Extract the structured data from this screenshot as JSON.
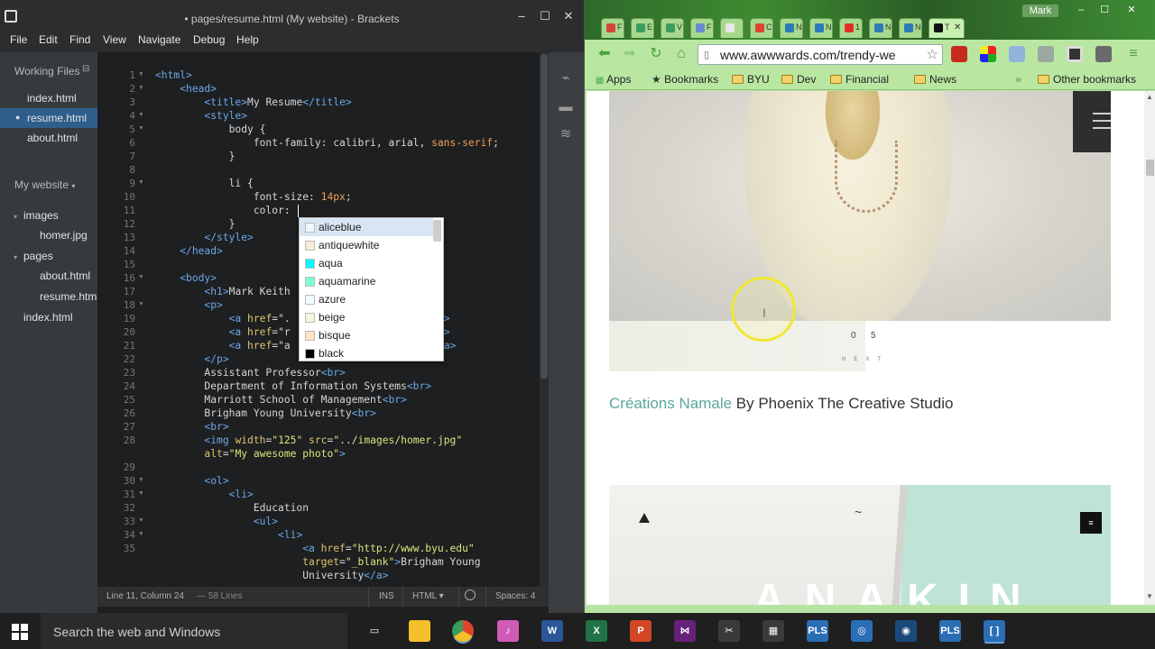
{
  "brackets": {
    "title": "• pages/resume.html (My website) - Brackets",
    "window_buttons": [
      "–",
      "☐",
      "✕"
    ],
    "menu": [
      "File",
      "Edit",
      "Find",
      "View",
      "Navigate",
      "Debug",
      "Help"
    ],
    "sidebar": {
      "working_files_label": "Working Files",
      "working_files": [
        "index.html",
        "resume.html",
        "about.html"
      ],
      "active_file_index": 1,
      "project_label": "My website",
      "tree": [
        {
          "label": "images",
          "type": "folder"
        },
        {
          "label": "homer.jpg",
          "type": "file"
        },
        {
          "label": "pages",
          "type": "folder"
        },
        {
          "label": "about.html",
          "type": "file"
        },
        {
          "label": "resume.html",
          "type": "file"
        },
        {
          "label": "index.html",
          "type": "file"
        }
      ]
    },
    "code_lines": [
      {
        "n": "1",
        "fold": true,
        "t": "<html>"
      },
      {
        "n": "2",
        "fold": true,
        "t": "    <head>"
      },
      {
        "n": "3",
        "fold": false,
        "t": "        <title>My Resume</title>"
      },
      {
        "n": "4",
        "fold": true,
        "t": "        <style>"
      },
      {
        "n": "5",
        "fold": true,
        "t": "            body {"
      },
      {
        "n": "6",
        "fold": false,
        "t": "                font-family: calibri, arial, sans-serif;"
      },
      {
        "n": "7",
        "fold": false,
        "t": "            }"
      },
      {
        "n": "8",
        "fold": false,
        "t": ""
      },
      {
        "n": "9",
        "fold": true,
        "t": "            li {"
      },
      {
        "n": "10",
        "fold": false,
        "t": "                font-size: 14px;"
      },
      {
        "n": "11",
        "fold": false,
        "t": "                color: "
      },
      {
        "n": "12",
        "fold": false,
        "t": "            }"
      },
      {
        "n": "13",
        "fold": false,
        "t": "        </style>"
      },
      {
        "n": "14",
        "fold": false,
        "t": "    </head>"
      },
      {
        "n": "15",
        "fold": false,
        "t": ""
      },
      {
        "n": "16",
        "fold": true,
        "t": "    <body>"
      },
      {
        "n": "17",
        "fold": false,
        "t": "        <h1>Mark Keith"
      },
      {
        "n": "18",
        "fold": true,
        "t": "        <p>"
      },
      {
        "n": "19",
        "fold": false,
        "t": "            <a href=\".                      <br>"
      },
      {
        "n": "20",
        "fold": false,
        "t": "            <a href=\"r                      <br>"
      },
      {
        "n": "21",
        "fold": false,
        "t": "            <a href=\"a                      e</a>"
      },
      {
        "n": "22",
        "fold": false,
        "t": "        </p>"
      },
      {
        "n": "23",
        "fold": false,
        "t": "        Assistant Professor<br>"
      },
      {
        "n": "24",
        "fold": false,
        "t": "        Department of Information Systems<br>"
      },
      {
        "n": "25",
        "fold": false,
        "t": "        Marriott School of Management<br>"
      },
      {
        "n": "26",
        "fold": false,
        "t": "        Brigham Young University<br>"
      },
      {
        "n": "27",
        "fold": false,
        "t": "        <br>"
      },
      {
        "n": "28",
        "fold": false,
        "t": "        <img width=\"125\" src=\"../images/homer.jpg\""
      },
      {
        "n": "",
        "fold": false,
        "t": "        alt=\"My awesome photo\">"
      },
      {
        "n": "29",
        "fold": false,
        "t": ""
      },
      {
        "n": "30",
        "fold": true,
        "t": "        <ol>"
      },
      {
        "n": "31",
        "fold": true,
        "t": "            <li>"
      },
      {
        "n": "32",
        "fold": false,
        "t": "                Education"
      },
      {
        "n": "33",
        "fold": true,
        "t": "                <ul>"
      },
      {
        "n": "34",
        "fold": true,
        "t": "                    <li>"
      },
      {
        "n": "35",
        "fold": false,
        "t": "                        <a href=\"http://www.byu.edu\""
      },
      {
        "n": "",
        "fold": false,
        "t": "                        target=\"_blank\">Brigham Young"
      },
      {
        "n": "",
        "fold": false,
        "t": "                        University</a>"
      }
    ],
    "hints": [
      {
        "name": "aliceblue",
        "color": "#f0f8ff"
      },
      {
        "name": "antiquewhite",
        "color": "#faebd7"
      },
      {
        "name": "aqua",
        "color": "#00ffff"
      },
      {
        "name": "aquamarine",
        "color": "#7fffd4"
      },
      {
        "name": "azure",
        "color": "#f0ffff"
      },
      {
        "name": "beige",
        "color": "#f5f5dc"
      },
      {
        "name": "bisque",
        "color": "#ffe4c4"
      },
      {
        "name": "black",
        "color": "#000000"
      }
    ],
    "status": {
      "position": "Line 11, Column 24",
      "lines": "— 58 Lines",
      "mode": "INS",
      "language": "HTML ▾",
      "spaces": "Spaces: 4"
    }
  },
  "chrome": {
    "user": "Mark",
    "window_buttons": [
      "–",
      "☐",
      "✕"
    ],
    "tabs": [
      {
        "letter": "F",
        "color": "#d44638"
      },
      {
        "letter": "E",
        "color": "#3a9d5d"
      },
      {
        "letter": "V",
        "color": "#3a9d5d"
      },
      {
        "letter": "F",
        "color": "#6a8ad0"
      },
      {
        "letter": "",
        "color": "#e8e8e8"
      },
      {
        "letter": "C",
        "color": "#e0442c"
      },
      {
        "letter": "N",
        "color": "#2b7bb9"
      },
      {
        "letter": "N",
        "color": "#2b7bb9"
      },
      {
        "letter": "1",
        "color": "#e52d27"
      },
      {
        "letter": "N",
        "color": "#2b7bb9"
      },
      {
        "letter": "N",
        "color": "#2b7bb9"
      },
      {
        "letter": "T",
        "color": "#111111"
      }
    ],
    "active_tab_close": "✕",
    "address": "www.awwwards.com/trendy-we",
    "bookmarks": [
      "Apps",
      "Bookmarks",
      "BYU",
      "Dev",
      "Financial",
      "News"
    ],
    "overflow": "»",
    "other_bookmarks": "Other bookmarks",
    "page": {
      "counter_current": "0",
      "counter_next": "5",
      "next_label": "NEXT",
      "caption_accent": "Créations Namale",
      "caption_rest": " By Phoenix The Creative Studio",
      "second_title": "ANAKIN"
    }
  },
  "taskbar": {
    "search_placeholder": "Search the web and Windows",
    "apps": [
      {
        "name": "task-view",
        "label": "▭",
        "color": "#1f1f1f"
      },
      {
        "name": "file-explorer",
        "label": "",
        "color": "#f3c02a"
      },
      {
        "name": "chrome",
        "label": "",
        "color": "#e0442c"
      },
      {
        "name": "itunes",
        "label": "♪",
        "color": "#d05cb8"
      },
      {
        "name": "word",
        "label": "W",
        "color": "#2b579a"
      },
      {
        "name": "excel",
        "label": "X",
        "color": "#217346"
      },
      {
        "name": "powerpoint",
        "label": "P",
        "color": "#d24726"
      },
      {
        "name": "visual-studio",
        "label": "⋈",
        "color": "#68217a"
      },
      {
        "name": "tool",
        "label": "✂",
        "color": "#3a3a3a"
      },
      {
        "name": "calculator",
        "label": "▦",
        "color": "#3a3a3a"
      },
      {
        "name": "pls-1",
        "label": "PLS",
        "color": "#2a6eb5"
      },
      {
        "name": "globe",
        "label": "◎",
        "color": "#2a6eb5"
      },
      {
        "name": "network",
        "label": "◉",
        "color": "#1a4a7a"
      },
      {
        "name": "pls-2",
        "label": "PLS",
        "color": "#2a6eb5"
      },
      {
        "name": "brackets",
        "label": "[ ]",
        "color": "#2a6eb5"
      }
    ]
  }
}
